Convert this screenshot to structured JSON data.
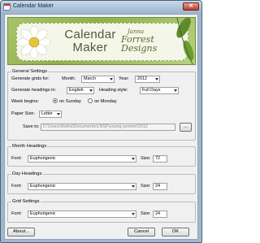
{
  "window": {
    "title": "Calendar Maker",
    "close_label": "✕"
  },
  "banner": {
    "title_line1": "Calendar",
    "title_line2": "Maker",
    "brand_pre": "Janna",
    "brand": "Forrest Designs"
  },
  "general": {
    "title": "General Settings",
    "grids_label": "Generate grids for:",
    "month_label": "Month:",
    "month_value": "March",
    "year_label": "Year:",
    "year_value": "2012",
    "headings_label": "Generate headings in:",
    "language_value": "English",
    "heading_style_label": "Heading style:",
    "heading_style_value": "Full Days",
    "week_label": "Week begins:",
    "sunday_label": "on Sunday",
    "monday_label": "on Monday",
    "week_selected": "sunday",
    "paper_label": "Paper Size:",
    "paper_value": "Letter",
    "save_label": "Save to:",
    "save_path": "C:\\Users\\Keiha\\Documents\\LNSF\\young women\\2012",
    "browse_label": "..."
  },
  "month_headings": {
    "title": "Month Headings",
    "font_label": "Font:",
    "font_value": "Euphorigenic",
    "size_label": "Size:",
    "size_value": "72"
  },
  "day_headings": {
    "title": "Day Headings",
    "font_label": "Font:",
    "font_value": "Euphorigenic",
    "size_label": "Size:",
    "size_value": "24"
  },
  "grid_settings": {
    "title": "Grid Settings",
    "font_label": "Font:",
    "font_value": "Euphorigenic",
    "size_label": "Size:",
    "size_value": "24"
  },
  "buttons": {
    "about": "About...",
    "cancel": "Cancel",
    "ok": "OK"
  }
}
